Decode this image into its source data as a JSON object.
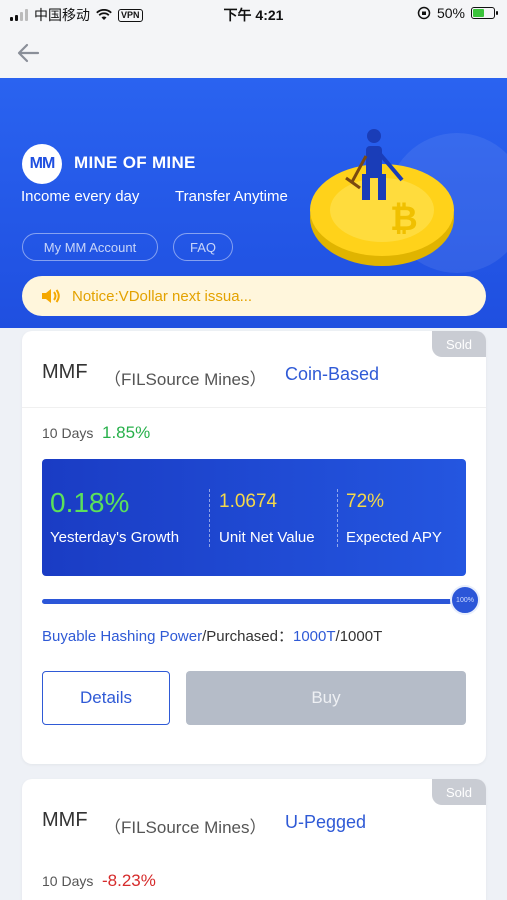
{
  "status_bar": {
    "carrier": "中国移动",
    "vpn": "VPN",
    "time": "下午 4:21",
    "battery": "50%"
  },
  "nav": {
    "back_icon": "arrow-left-icon"
  },
  "hero": {
    "logo_mark": "MM",
    "brand": "MINE OF MINE",
    "slogan_1": "Income every day",
    "slogan_2": "Transfer Anytime",
    "account_link": "My MM Account",
    "faq_link": "FAQ",
    "illustration": "coin-miner-illustration"
  },
  "notice": {
    "icon": "speaker-icon",
    "text": "Notice:VDollar next issua..."
  },
  "colors": {
    "brand_blue": "#2a63f0",
    "accent_blue": "#2f5ad6",
    "positive": "#27b04a",
    "negative": "#d62b2b",
    "notice_text": "#e3a200"
  },
  "products": [
    {
      "badge": "Sold",
      "title": "MMF",
      "source": "（FILSource Mines）",
      "type": "Coin-Based",
      "period": "10 Days",
      "rate": "1.85%",
      "growth": "0.18%",
      "growth_label": "Yesterday's Growth",
      "nav_value": "1.0674",
      "nav_label": "Unit Net Value",
      "apy": "72%",
      "apy_label": "Expected APY",
      "progress_label": "100%",
      "progress": 1.0,
      "hash_label": "Buyable Hashing Power",
      "purchased_label": "/Purchased：",
      "buyable": "1000T",
      "total": "/1000T",
      "details_label": "Details",
      "buy_label": "Buy"
    },
    {
      "badge": "Sold",
      "title": "MMF",
      "source": "（FILSource Mines）",
      "type": "U-Pegged",
      "period": "10 Days",
      "rate": "-8.23%"
    }
  ]
}
